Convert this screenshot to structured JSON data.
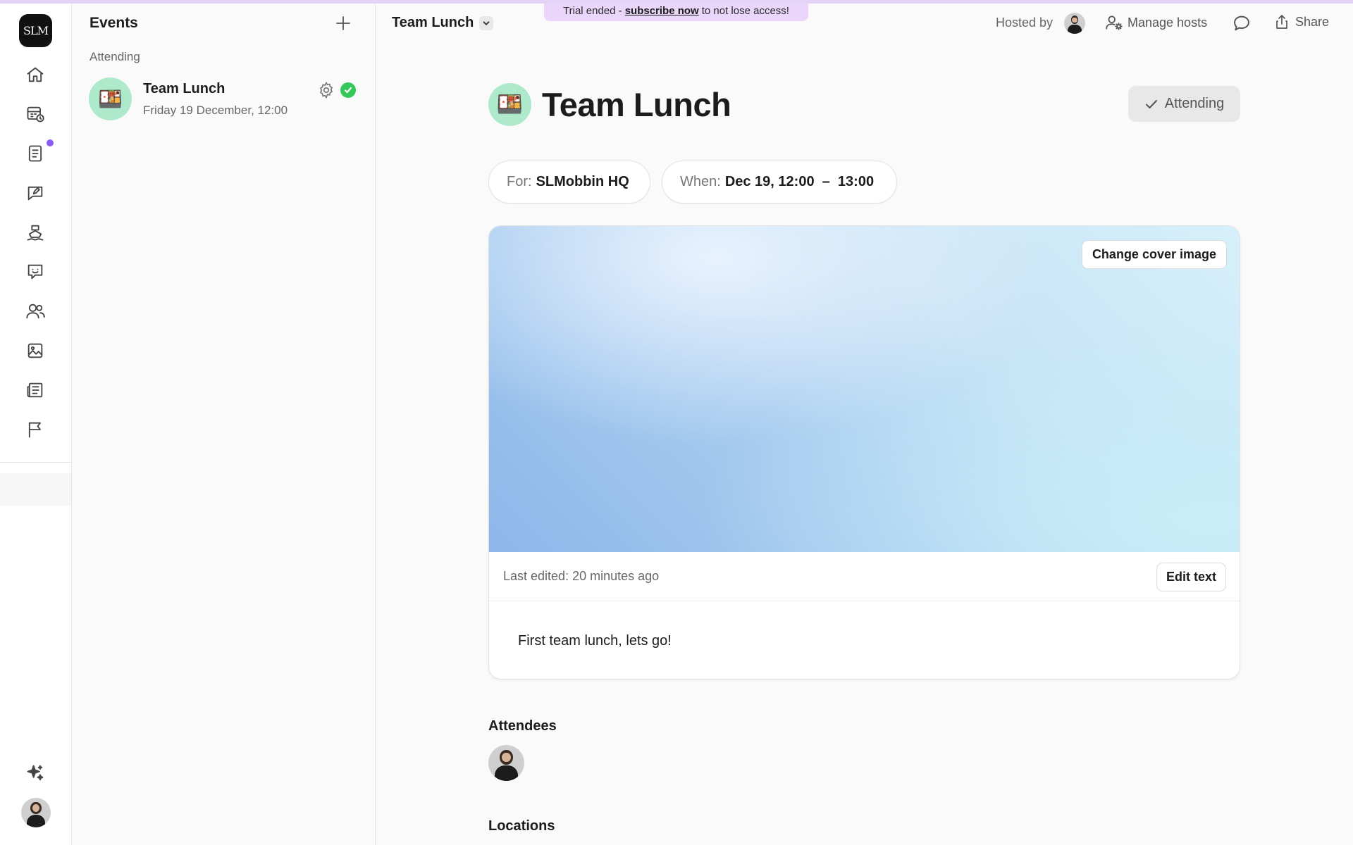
{
  "app": {
    "logo_text": "SLM"
  },
  "rail": {
    "icons": [
      "home-icon",
      "calendar-clock-icon",
      "notebook-icon",
      "chat-edit-icon",
      "boat-icon",
      "chat-smile-icon",
      "people-icon",
      "image-icon",
      "newspaper-icon",
      "flag-icon",
      "sparkles-icon"
    ],
    "notification_color": "#8b5cf6"
  },
  "events_panel": {
    "title": "Events",
    "section_label": "Attending",
    "items": [
      {
        "name": "Team Lunch",
        "date": "Friday 19 December, 12:00",
        "emoji": "🍱",
        "status": "attending"
      }
    ]
  },
  "header": {
    "breadcrumb": "Team Lunch",
    "trial_banner": {
      "prefix": "Trial ended -",
      "link": "subscribe now",
      "suffix": "to not lose access!"
    },
    "hosted_by_label": "Hosted by",
    "manage_hosts_label": "Manage hosts",
    "share_label": "Share"
  },
  "event": {
    "emoji": "🍱",
    "title": "Team Lunch",
    "attending_label": "Attending",
    "for_key": "For:",
    "for_value": "SLMobbin HQ",
    "when_key": "When:",
    "when_value": "Dec 19, 12:00  –  13:00",
    "change_cover_label": "Change cover image",
    "last_edited": "Last edited: 20 minutes ago",
    "edit_text_label": "Edit text",
    "description": "First team lunch, lets go!",
    "attendees_heading": "Attendees",
    "locations_heading": "Locations"
  },
  "colors": {
    "accent_purple": "#8b5cf6",
    "trial_banner_bg": "#ead6fb",
    "event_avatar_bg": "#aee9cc",
    "attending_green": "#34c759"
  }
}
